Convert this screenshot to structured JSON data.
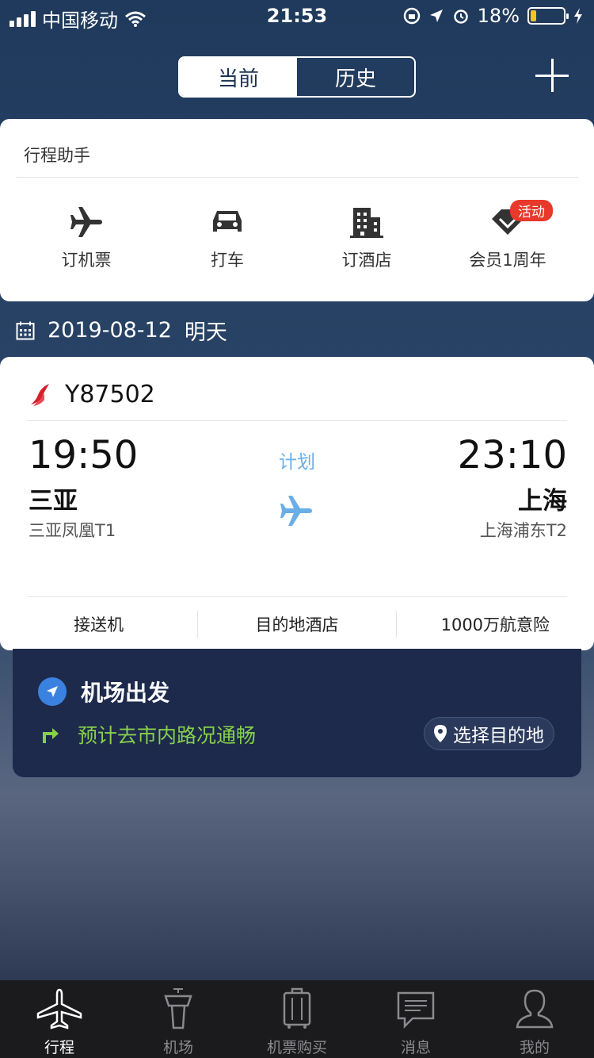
{
  "status_bar": {
    "carrier": "中国移动",
    "time": "21:53",
    "battery": "18%",
    "battery_level": 0.18
  },
  "segment": {
    "current": "当前",
    "history": "历史"
  },
  "assistant": {
    "title": "行程助手",
    "items": [
      {
        "label": "订机票",
        "icon": "airplane-icon"
      },
      {
        "label": "打车",
        "icon": "car-icon"
      },
      {
        "label": "订酒店",
        "icon": "hotel-icon"
      },
      {
        "label": "会员1周年",
        "icon": "membership-icon"
      }
    ],
    "badge": "活动"
  },
  "date": {
    "date": "2019-08-12",
    "relative": "明天"
  },
  "flight": {
    "number": "Y87502",
    "dep_time": "19:50",
    "arr_time": "23:10",
    "status": "计划",
    "dep_city": "三亚",
    "arr_city": "上海",
    "dep_terminal": "三亚凤凰T1",
    "arr_terminal": "上海浦东T2",
    "services": [
      "接送机",
      "目的地酒店",
      "1000万航意险"
    ]
  },
  "airport": {
    "title": "机场出发",
    "traffic": "预计去市内路况通畅",
    "dest_button": "选择目的地"
  },
  "tabs": [
    {
      "label": "行程",
      "active": true
    },
    {
      "label": "机场",
      "active": false
    },
    {
      "label": "机票购买",
      "active": false
    },
    {
      "label": "消息",
      "active": false
    },
    {
      "label": "我的",
      "active": false
    }
  ],
  "colors": {
    "accent_blue": "#6aaee8",
    "traffic_green": "#86d04a",
    "badge_red": "#e8392b",
    "airport_card": "#1d2a4c"
  }
}
